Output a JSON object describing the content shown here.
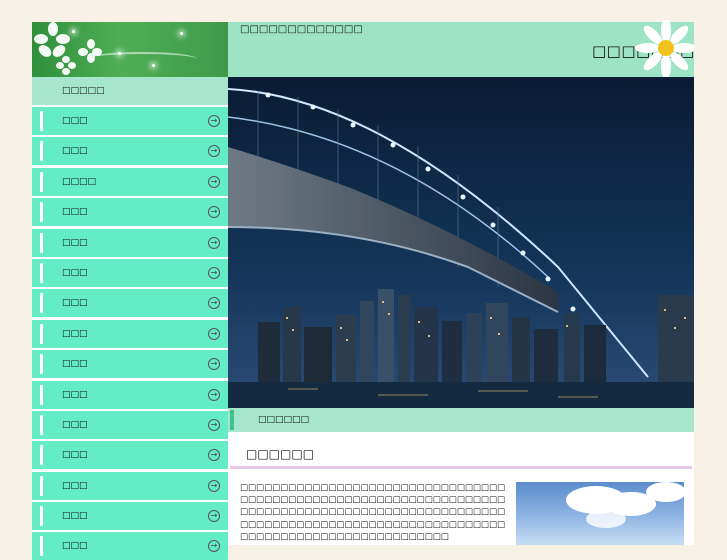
{
  "header": {
    "tagline": "□□□□□□□□□□□□□",
    "site_title": "□□□□□□□"
  },
  "sidebar": {
    "heading": "□□□□□",
    "items": [
      {
        "label": "□□□"
      },
      {
        "label": "□□□"
      },
      {
        "label": "□□□□"
      },
      {
        "label": "□□□"
      },
      {
        "label": "□□□"
      },
      {
        "label": "□□□"
      },
      {
        "label": "□□□"
      },
      {
        "label": "□□□"
      },
      {
        "label": "□□□"
      },
      {
        "label": "□□□"
      },
      {
        "label": "□□□"
      },
      {
        "label": "□□□"
      },
      {
        "label": "□□□"
      },
      {
        "label": "□□□"
      },
      {
        "label": "□□□"
      }
    ]
  },
  "section": {
    "heading": "□□□□□□",
    "article_title": "□□□□□□",
    "body": "□□□□□□□□□□□□□□□□□□□□□□□□□□□□□□□□□□□□□□□□□□□□□□□□□□□□□□□□□□□□□□□□□□□□□□□□□□□□□□□□□□□□□□□□□□□□□□□□□□□□□□□□□□□□□□□□□□□□□□□□□□□□□□□□□□□□□□□□□□□□□□□□□□□□□□□□□□□□□□"
  },
  "icons": {
    "sidebar_arrow": "→"
  },
  "colors": {
    "page_bg": "#f7f1e6",
    "nav_item": "#63ecc5",
    "band": "#9fe3c6",
    "logo_green": "#3e9a4a",
    "rule": "#e8c6e8"
  }
}
